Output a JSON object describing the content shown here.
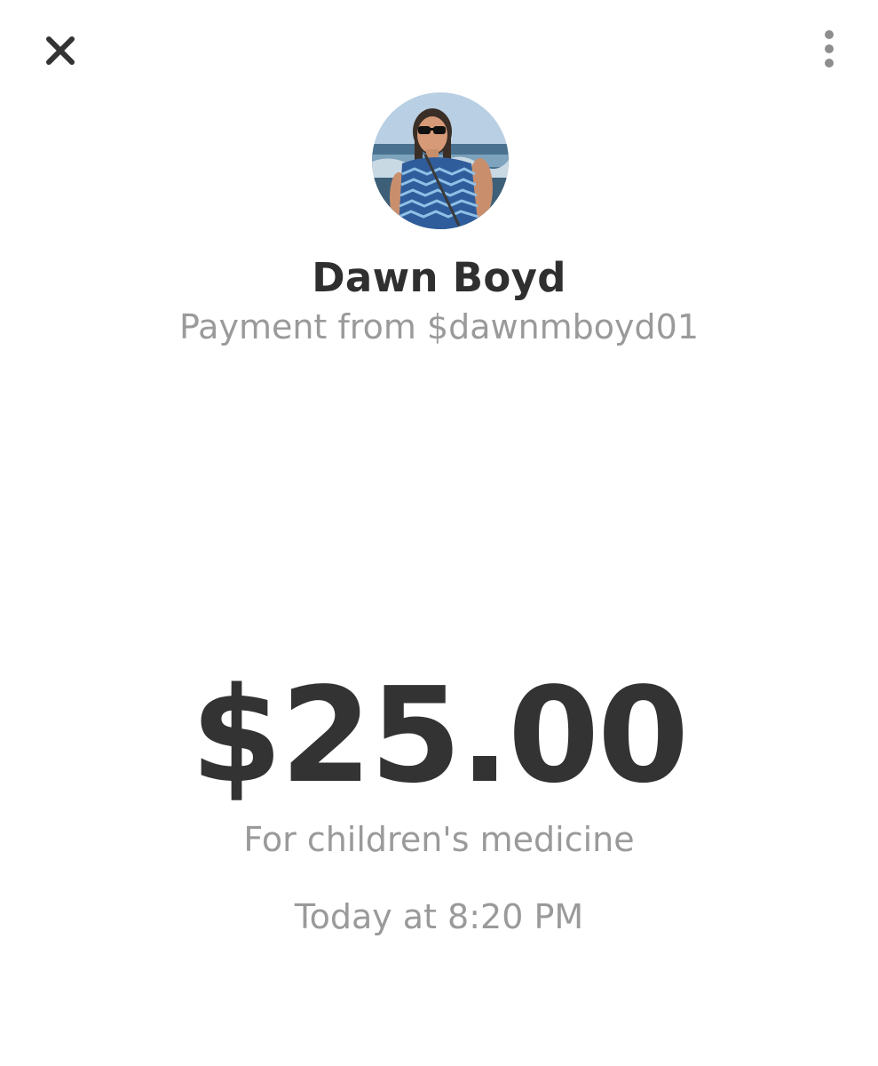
{
  "header": {
    "close_icon": "close-icon",
    "more_icon": "more-vertical-icon"
  },
  "sender": {
    "name": "Dawn Boyd",
    "subtitle": "Payment from $dawnmboyd01"
  },
  "payment": {
    "amount": "$25.00",
    "memo": "For children's medicine",
    "timestamp": "Today at 8:20 PM"
  },
  "colors": {
    "text_primary": "#333333",
    "text_secondary": "#9a9a9a",
    "background": "#ffffff"
  }
}
